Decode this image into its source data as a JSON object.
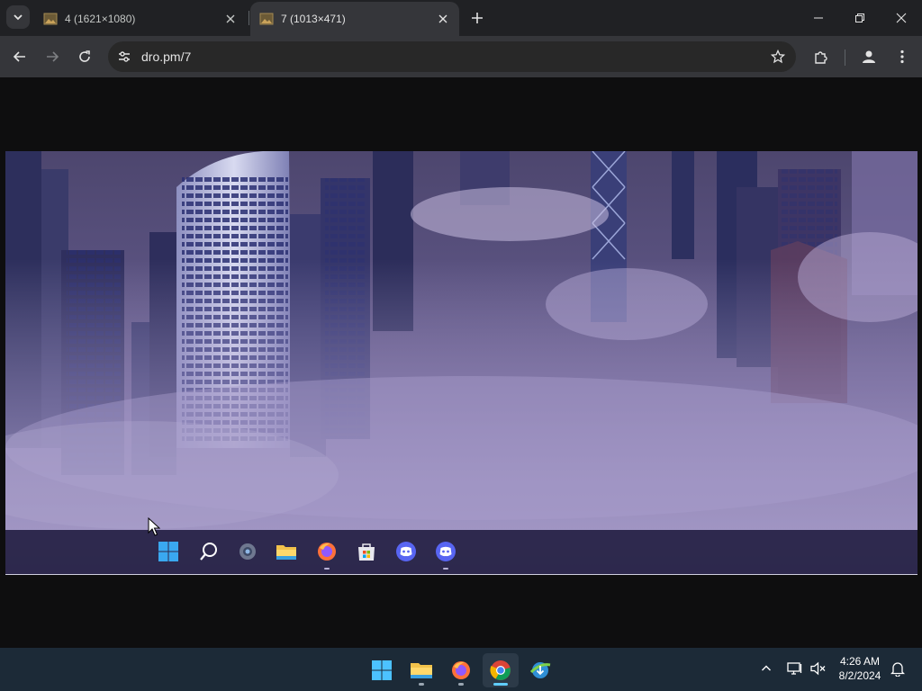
{
  "browser": {
    "tabs": [
      {
        "title": "4 (1621×1080)",
        "active": false
      },
      {
        "title": "7 (1013×471)",
        "active": true
      }
    ],
    "url": "dro.pm/7",
    "icons": {
      "tab_search": "chevron-down-icon",
      "new_tab": "plus-icon",
      "back": "arrow-left-icon",
      "forward": "arrow-right-icon",
      "reload": "reload-icon",
      "site_info": "tune-icon",
      "bookmark": "star-icon",
      "extensions": "puzzle-icon",
      "profile": "person-icon",
      "menu": "more-vertical-icon"
    }
  },
  "image": {
    "dimensions_label": "1013×471",
    "description_taskbar_apps": [
      "start",
      "search",
      "settings",
      "file-explorer",
      "firefox",
      "store",
      "discord",
      "discord"
    ]
  },
  "taskbar": {
    "apps": [
      "start",
      "file-explorer",
      "firefox",
      "chrome",
      "internet-download-manager"
    ],
    "active_app": "chrome",
    "clock": {
      "time": "4:26 AM",
      "date": "8/2/2024"
    }
  },
  "colors": {
    "chrome_dark": "#202124",
    "toolbar": "#35363a",
    "taskbar": "#1c2a37",
    "accent": "#60cdff"
  }
}
